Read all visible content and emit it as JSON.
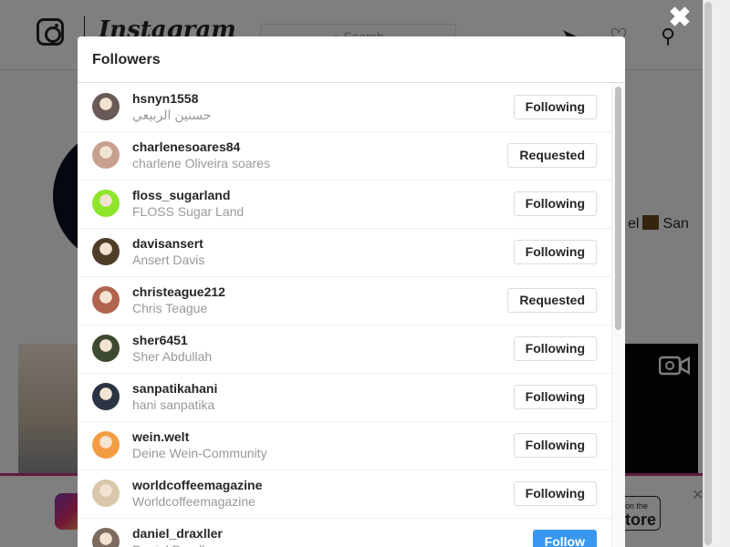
{
  "background": {
    "brand": "Instagram",
    "search_placeholder": "Search",
    "nav_icons": [
      "compass-icon",
      "heart-icon",
      "profile-icon"
    ],
    "bio_tail_before": "el",
    "bio_tail_after": "San",
    "appstore_small": "on the",
    "appstore_big": "tore"
  },
  "modal": {
    "title": "Followers",
    "followers": [
      {
        "username": "hsnyn1558",
        "fullname": "حسنين الربيعي",
        "button": "Following",
        "button_style": "secondary",
        "avatar_color": "#6a5a57"
      },
      {
        "username": "charlenesoares84",
        "fullname": "charlene Oliveira soares",
        "button": "Requested",
        "button_style": "secondary",
        "avatar_color": "#c8a08f"
      },
      {
        "username": "floss_sugarland",
        "fullname": "FLOSS Sugar Land",
        "button": "Following",
        "button_style": "secondary",
        "avatar_color": "#8ee52a"
      },
      {
        "username": "davisansert",
        "fullname": "Ansert Davis",
        "button": "Following",
        "button_style": "secondary",
        "avatar_color": "#4e3e28"
      },
      {
        "username": "christeague212",
        "fullname": "Chris Teague",
        "button": "Requested",
        "button_style": "secondary",
        "avatar_color": "#b1644f"
      },
      {
        "username": "sher6451",
        "fullname": "Sher Abdullah",
        "button": "Following",
        "button_style": "secondary",
        "avatar_color": "#3e4a2f"
      },
      {
        "username": "sanpatikahani",
        "fullname": "hani sanpatika",
        "button": "Following",
        "button_style": "secondary",
        "avatar_color": "#2b3442"
      },
      {
        "username": "wein.welt",
        "fullname": "Deine Wein-Community",
        "button": "Following",
        "button_style": "secondary",
        "avatar_color": "#f29d44"
      },
      {
        "username": "worldcoffeemagazine",
        "fullname": "Worldcoffeemagazine",
        "button": "Following",
        "button_style": "secondary",
        "avatar_color": "#d8c7a8"
      },
      {
        "username": "daniel_draxller",
        "fullname": "Daniel Draxller",
        "button": "Follow",
        "button_style": "primary",
        "avatar_color": "#7c6b5f"
      }
    ]
  },
  "colors": {
    "accent": "#3897f0",
    "overlay": "rgba(0,0,0,0.5)",
    "brand_gradient": [
      "#833ab4",
      "#e1306c",
      "#fcb045"
    ]
  }
}
